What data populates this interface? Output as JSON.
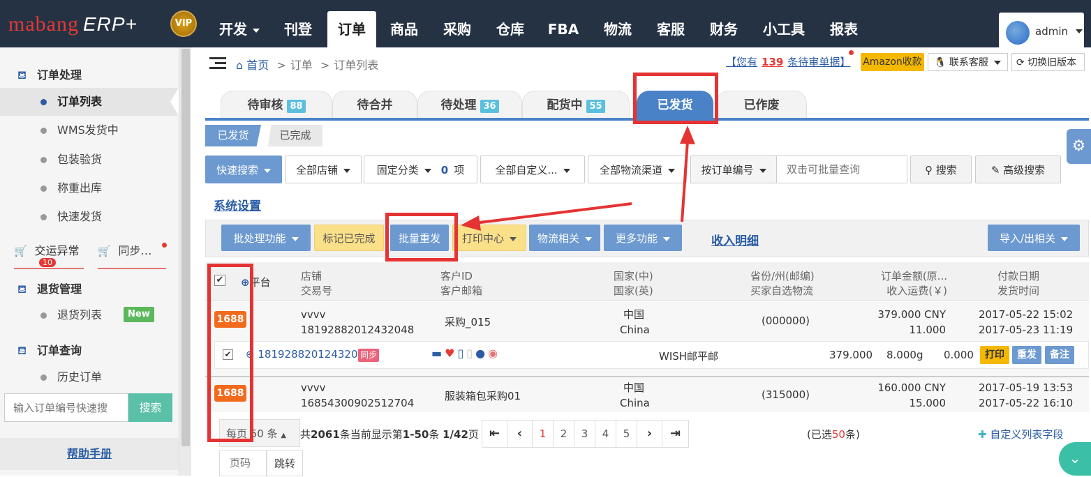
{
  "brand": {
    "logo": "mabang",
    "logo_suffix": "ERP+",
    "vip": "VIP"
  },
  "nav": [
    "开发",
    "刊登",
    "订单",
    "商品",
    "采购",
    "仓库",
    "FBA",
    "物流",
    "客服",
    "财务",
    "小工具",
    "报表"
  ],
  "user": "admin",
  "sidebar": {
    "group1": "订单处理",
    "items1": [
      "订单列表",
      "WMS发货中",
      "包装验货",
      "称重出库",
      "快速发货"
    ],
    "exception": "交运异常",
    "exception_count": "10",
    "sync": "同步…",
    "group2": "退货管理",
    "items2": [
      "退货列表"
    ],
    "new_badge": "New",
    "group3": "订单查询",
    "items3": [
      "历史订单"
    ],
    "quick_placeholder": "输入订单编号快速搜",
    "quick_search": "搜索",
    "help": "帮助手册"
  },
  "breadcrumb": [
    "首页",
    "订单",
    "订单列表"
  ],
  "pending": {
    "prefix": "【您有",
    "count": "139",
    "suffix": "条待审单据】"
  },
  "top_buttons": [
    "Amazon收款",
    "联系客服",
    "切换旧版本"
  ],
  "tabs": [
    {
      "label": "待审核",
      "count": "88"
    },
    {
      "label": "待合并",
      "count": ""
    },
    {
      "label": "待处理",
      "count": "36"
    },
    {
      "label": "配货中",
      "count": "55"
    },
    {
      "label": "已发货",
      "count": ""
    },
    {
      "label": "已作废",
      "count": ""
    }
  ],
  "subtabs": [
    "已发货",
    "已完成"
  ],
  "filters": {
    "quick": "快速搜索",
    "shop": "全部店铺",
    "fixed": "固定分类",
    "fixed_count": "0",
    "fixed_unit": "项",
    "custom": "全部自定义...",
    "logistics": "全部物流渠道",
    "by": "按订单编号",
    "placeholder": "双击可批量查询",
    "search": "搜索",
    "advanced": "高级搜索"
  },
  "sys_settings": "系统设置",
  "actions": {
    "batch": "批处理功能",
    "mark": "标记已完成",
    "resend": "批量重发",
    "print": "打印中心",
    "logistics": "物流相关",
    "more": "更多功能",
    "income": "收入明细",
    "import_export": "导入/出相关"
  },
  "headers": {
    "platform": "平台",
    "shop": "店铺",
    "trade": "交易号",
    "cid": "客户ID",
    "cmail": "客户邮箱",
    "country_cn": "国家(中)",
    "country_en": "国家(英)",
    "province": "省份/州(邮编)",
    "buyer_logistics": "买家自选物流",
    "amount": "订单金额(原...",
    "income_freight": "收入运费(￥)",
    "pay_date": "付款日期",
    "ship_time": "发货时间"
  },
  "orders": [
    {
      "platform": "1688",
      "shop": "vvvv",
      "trade": "18192882012432048",
      "cid": "采购_015",
      "cn": "中国",
      "en": "China",
      "zip": "(000000)",
      "amount": "379.000 CNY",
      "freight": "11.000",
      "pay": "2017-05-22 15:02",
      "ship": "2017-05-23 11:19",
      "item": {
        "order_no": "18192882012432048",
        "sync": "同步",
        "logistics": "WISH邮平邮",
        "price": "379.000",
        "weight": "8.000g",
        "fee": "0.000",
        "b_print": "打印",
        "b_resend": "重发",
        "b_note": "备注"
      }
    },
    {
      "platform": "1688",
      "shop": "vvvv",
      "trade": "16854300902512704",
      "cid": "服装箱包采购01",
      "cn": "中国",
      "en": "China",
      "zip": "(315000)",
      "amount": "160.000 CNY",
      "freight": "15.000",
      "pay": "2017-05-19 13:53",
      "ship": "2017-05-22 16:10"
    }
  ],
  "pagination": {
    "per_page": "每页 50 条",
    "summary_a": "共",
    "total": "2061",
    "summary_b": "条当前显示第",
    "range": "1-50",
    "summary_c": "条",
    "pages": "1/42",
    "summary_d": "页",
    "page_numbers": [
      "1",
      "2",
      "3",
      "4",
      "5"
    ],
    "selected_a": "(已选",
    "selected": "50",
    "selected_b": "条)",
    "custom": "自定义列表字段",
    "page_input": "页码",
    "goto": "跳转"
  },
  "colors": {
    "topbar": "#253244",
    "accent": "#4a82c8",
    "annotation": "#e53333"
  }
}
